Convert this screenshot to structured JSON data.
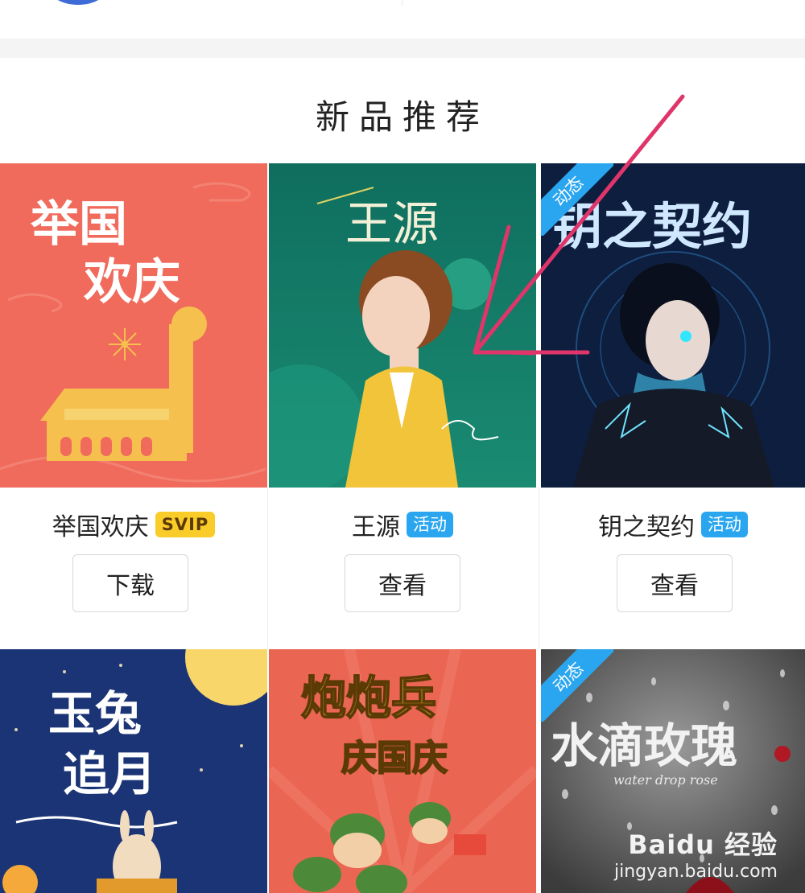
{
  "section": {
    "title": "新品推荐"
  },
  "products": [
    {
      "name": "举国欢庆",
      "badge": "SVIP",
      "badge_type": "svip",
      "button": "下载",
      "art_title_lines": [
        "举国",
        "欢庆"
      ],
      "art_bg": "#f06b5c",
      "corner_tag": ""
    },
    {
      "name": "王源",
      "badge": "活动",
      "badge_type": "activity",
      "button": "查看",
      "art_title_lines": [
        "王源"
      ],
      "art_bg": "#16806c",
      "corner_tag": ""
    },
    {
      "name": "钥之契约",
      "badge": "活动",
      "badge_type": "activity",
      "button": "查看",
      "art_title_lines": [
        "钥之契约"
      ],
      "art_bg": "#0d1e3e",
      "corner_tag": "动态"
    },
    {
      "name": "",
      "badge": "",
      "button": "",
      "art_title_lines": [
        "玉兔",
        "追月"
      ],
      "art_bg": "#1b3475",
      "corner_tag": ""
    },
    {
      "name": "",
      "badge": "",
      "button": "",
      "art_title_lines": [
        "炮炮兵",
        "庆国庆"
      ],
      "art_bg": "#ea6552",
      "corner_tag": ""
    },
    {
      "name": "",
      "badge": "",
      "button": "",
      "art_title_lines": [
        "水滴玫瑰",
        "water drop rose"
      ],
      "art_bg": "#6c6c6c",
      "corner_tag": "动态"
    }
  ],
  "watermark": {
    "logo": "Baidu 经验",
    "url": "jingyan.baidu.com"
  },
  "colors": {
    "svip": "#f9cc2a",
    "activity": "#2aa6f0",
    "annotation_arrow": "#e0356a"
  }
}
